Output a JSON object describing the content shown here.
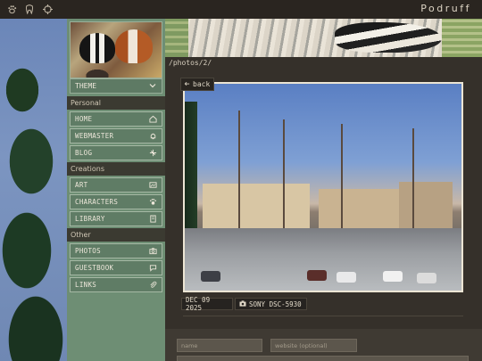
{
  "topbar": {
    "icons": [
      "pawprint-icon",
      "tooth-icon",
      "crosshair-icon"
    ],
    "brand": "Podruff"
  },
  "sidebar": {
    "theme_label": "THEME",
    "sections": [
      {
        "label": "Personal",
        "items": [
          {
            "label": "HOME",
            "icon": "home-icon"
          },
          {
            "label": "WEBMASTER",
            "icon": "bell-icon"
          },
          {
            "label": "BLOG",
            "icon": "blog-icon"
          }
        ]
      },
      {
        "label": "Creations",
        "items": [
          {
            "label": "ART",
            "icon": "image-icon"
          },
          {
            "label": "CHARACTERS",
            "icon": "paw-icon"
          },
          {
            "label": "LIBRARY",
            "icon": "book-icon"
          }
        ]
      },
      {
        "label": "Other",
        "items": [
          {
            "label": "PHOTOS",
            "icon": "camera-icon"
          },
          {
            "label": "GUESTBOOK",
            "icon": "speech-bubble-icon"
          },
          {
            "label": "LINKS",
            "icon": "paperclip-icon"
          }
        ]
      }
    ]
  },
  "main": {
    "path": "/photos/2/",
    "back_label": "back",
    "date": "DEC 09 2025",
    "camera": "SONY DSC-5930",
    "form": {
      "name_placeholder": "name",
      "website_placeholder": "website (optional)"
    }
  },
  "colors": {
    "sidebar": "#6e8e74",
    "nav_item": "#5f7c65",
    "main_bg": "#35302a",
    "topbar": "#2a2520"
  }
}
